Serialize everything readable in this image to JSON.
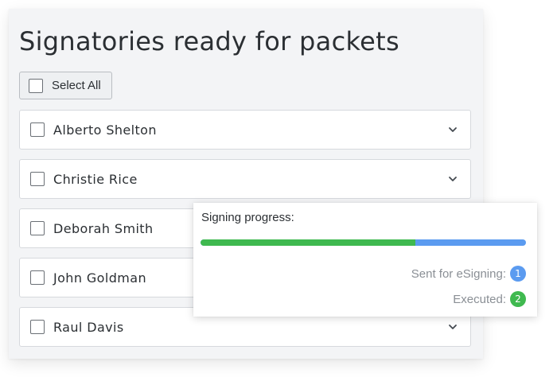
{
  "title": "Signatories ready for packets",
  "select_all": {
    "label": "Select All",
    "checked": false
  },
  "signatories": [
    {
      "name": "Alberto Shelton",
      "checked": false,
      "expandable": true
    },
    {
      "name": "Christie Rice",
      "checked": false,
      "expandable": true
    },
    {
      "name": "Deborah Smith",
      "checked": false,
      "expandable": true
    },
    {
      "name": "John Goldman",
      "checked": false,
      "expandable": true
    },
    {
      "name": "Raul Davis",
      "checked": false,
      "expandable": true
    }
  ],
  "progress_card": {
    "title": "Signing progress:",
    "progress_fraction": 0.66,
    "sent": {
      "label": "Sent for eSigning:",
      "count": "1",
      "color": "#5b9bf0"
    },
    "executed": {
      "label": "Executed:",
      "count": "2",
      "color": "#3fb94f"
    }
  },
  "icons": {
    "row_toggle": "chevron-down-icon",
    "checkbox": "checkbox-icon"
  }
}
